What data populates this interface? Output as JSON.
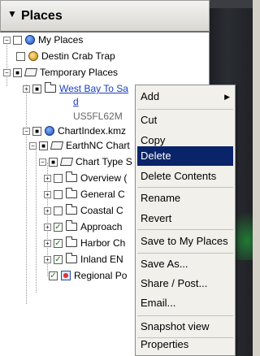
{
  "panel": {
    "title": "Places",
    "collapse_arrow": "▼"
  },
  "tree": {
    "my_places": "My Places",
    "destin_crab_trap": "Destin Crab Trap",
    "temporary_places": "Temporary Places",
    "west_bay_line1": "West Bay To Sa",
    "west_bay_line2": "d",
    "west_bay_id": "US5FL62M",
    "chartindex": "ChartIndex.kmz",
    "earthnc": "EarthNC Chart",
    "chart_type": "Chart Type S",
    "overview": "Overview (",
    "general": "General C",
    "coastal": "Coastal C",
    "approach": "Approach",
    "harbor": "Harbor Ch",
    "inland": "Inland EN",
    "regional": "Regional Po"
  },
  "context_menu": {
    "items": [
      {
        "label": "Add",
        "has_submenu": true
      },
      {
        "label": "Cut"
      },
      {
        "label": "Copy"
      },
      {
        "label": "Delete",
        "selected": true
      },
      {
        "label": "Delete Contents"
      },
      {
        "label": "Rename"
      },
      {
        "label": "Revert"
      },
      {
        "label": "Save to My Places"
      },
      {
        "label": "Save As..."
      },
      {
        "label": "Share / Post..."
      },
      {
        "label": "Email..."
      },
      {
        "label": "Snapshot view"
      },
      {
        "label": "Properties"
      }
    ],
    "submenu_arrow": "▶",
    "selected_color": "#0a246a"
  }
}
